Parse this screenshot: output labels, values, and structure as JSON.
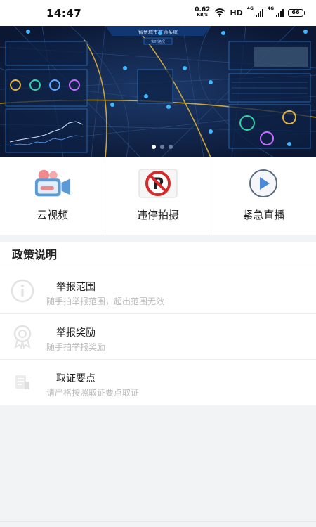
{
  "status_bar": {
    "time": "14:47",
    "net_speed_value": "0.62",
    "net_speed_unit": "KB/S",
    "hd_label": "HD",
    "sim1_label": "4G",
    "sim2_label": "4G",
    "battery": "66"
  },
  "banner": {
    "title": "智慧城市交通系统",
    "subtitle": "实时路况"
  },
  "actions": [
    {
      "label": "云视频",
      "icon": "camcorder-icon"
    },
    {
      "label": "违停拍摄",
      "icon": "no-parking-icon"
    },
    {
      "label": "紧急直播",
      "icon": "play-circle-icon"
    }
  ],
  "policy": {
    "title": "政策说明",
    "items": [
      {
        "title": "举报范围",
        "subtitle": "随手拍举报范围，超出范围无效",
        "icon": "info-icon"
      },
      {
        "title": "举报奖励",
        "subtitle": "随手拍举报奖励",
        "icon": "award-ribbon-icon"
      },
      {
        "title": "取证要点",
        "subtitle": "请严格按照取证要点取证",
        "icon": "document-icon"
      }
    ]
  },
  "colors": {
    "banner_bg": "#0b1733",
    "accent_red": "#d62b2b",
    "accent_blue": "#4a8ad8",
    "camera_pink": "#f08a8f",
    "camera_blue": "#5b9bd5"
  }
}
